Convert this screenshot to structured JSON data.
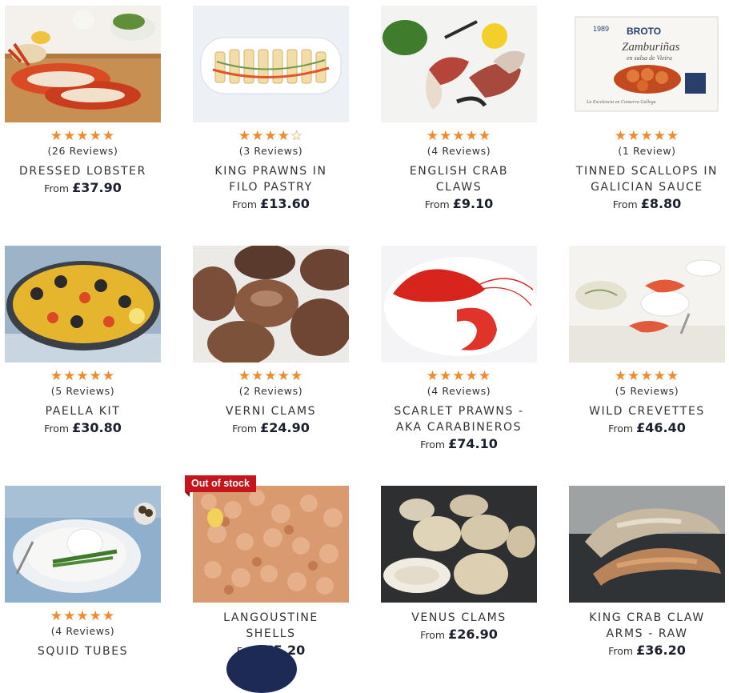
{
  "products": [
    {
      "name": "DRESSED LOBSTER",
      "stars": "★★★★★",
      "reviews": "(26 Reviews)",
      "from": "From",
      "price": "£37.90"
    },
    {
      "name": "KING PRAWNS IN FILO PASTRY",
      "stars": "★★★★☆",
      "reviews": "(3 Reviews)",
      "from": "From",
      "price": "£13.60"
    },
    {
      "name": "ENGLISH CRAB CLAWS",
      "stars": "★★★★★",
      "reviews": "(4 Reviews)",
      "from": "From",
      "price": "£9.10"
    },
    {
      "name": "TINNED SCALLOPS IN GALICIAN SAUCE",
      "stars": "★★★★★",
      "reviews": "(1 Review)",
      "from": "From",
      "price": "£8.80"
    },
    {
      "name": "PAELLA KIT",
      "stars": "★★★★★",
      "reviews": "(5 Reviews)",
      "from": "From",
      "price": "£30.80"
    },
    {
      "name": "VERNI CLAMS",
      "stars": "★★★★★",
      "reviews": "(2 Reviews)",
      "from": "From",
      "price": "£24.90"
    },
    {
      "name": "SCARLET PRAWNS - AKA CARABINEROS",
      "stars": "★★★★★",
      "reviews": "(4 Reviews)",
      "from": "From",
      "price": "£74.10"
    },
    {
      "name": "WILD CREVETTES",
      "stars": "★★★★★",
      "reviews": "(5 Reviews)",
      "from": "From",
      "price": "£46.40"
    },
    {
      "name": "SQUID TUBES",
      "stars": "★★★★★",
      "reviews": "(4 Reviews)",
      "from": "",
      "price": ""
    },
    {
      "name": "LANGOUSTINE SHELLS",
      "stars": "",
      "reviews": "",
      "from": "From",
      "price": "£5.20"
    },
    {
      "name": "VENUS CLAMS",
      "stars": "",
      "reviews": "",
      "from": "From",
      "price": "£26.90"
    },
    {
      "name": "KING CRAB CLAW ARMS - RAW",
      "stars": "",
      "reviews": "",
      "from": "From",
      "price": "£36.20"
    }
  ],
  "badges": {
    "out_of_stock": "Out of stock"
  },
  "tin_label": {
    "brand": "BROTO",
    "year": "1989",
    "product": "Zamburiñas",
    "subtitle": "en salsa de Vieira",
    "tagline": "La Excelencia en Conserva Gallega"
  },
  "colors": {
    "star": "#f08a2a",
    "price": "#1b1f2e",
    "badge": "#c4161c",
    "chat": "#1d2a55"
  }
}
